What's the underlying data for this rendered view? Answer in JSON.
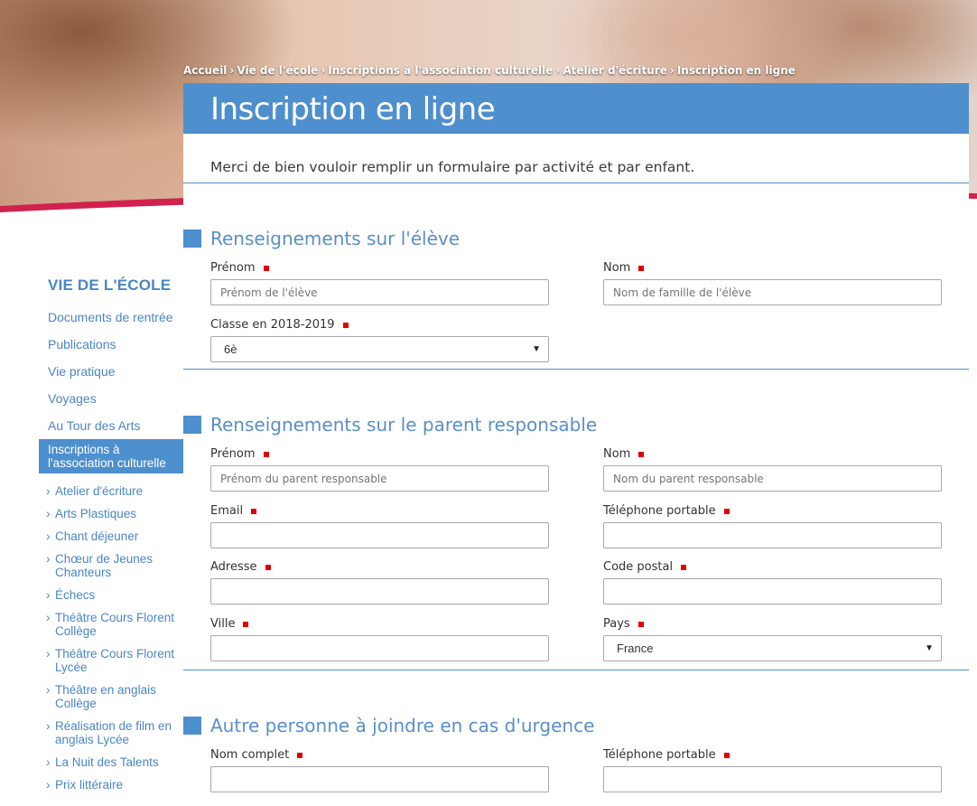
{
  "breadcrumb": {
    "items": [
      "Accueil",
      "Vie de l'école",
      "Inscriptions à l'association culturelle",
      "Atelier d'écriture",
      "Inscription en ligne"
    ]
  },
  "sidebar": {
    "title": "VIE DE L'ÉCOLE",
    "items": [
      "Documents de rentrée",
      "Publications",
      "Vie pratique",
      "Voyages",
      "Au Tour des Arts"
    ],
    "active": "Inscriptions à l'association culturelle",
    "subitems": [
      "Atelier d'écriture",
      "Arts Plastiques",
      "Chant déjeuner",
      "Chœur de Jeunes Chanteurs",
      "Échecs",
      "Théâtre Cours Florent Collège",
      "Théâtre Cours Florent Lycée",
      "Théâtre en anglais Collège",
      "Réalisation de film en anglais Lycée",
      "La Nuit des Talents",
      "Prix littéraire"
    ]
  },
  "page": {
    "title": "Inscription en ligne",
    "intro": "Merci de bien vouloir remplir un formulaire par activité et par enfant."
  },
  "sections": {
    "eleve": {
      "title": "Renseignements sur l'élève",
      "prenom": {
        "label": "Prénom",
        "placeholder": "Prénom de l'élève"
      },
      "nom": {
        "label": "Nom",
        "placeholder": "Nom de famille de l'élève"
      },
      "classe": {
        "label": "Classe en 2018-2019",
        "value": "6è"
      }
    },
    "parent": {
      "title": "Renseignements sur le parent responsable",
      "prenom": {
        "label": "Prénom",
        "placeholder": "Prénom du parent responsable"
      },
      "nom": {
        "label": "Nom",
        "placeholder": "Nom du parent responsable"
      },
      "email": {
        "label": "Email"
      },
      "telephone": {
        "label": "Téléphone portable"
      },
      "adresse": {
        "label": "Adresse"
      },
      "code_postal": {
        "label": "Code postal"
      },
      "ville": {
        "label": "Ville"
      },
      "pays": {
        "label": "Pays",
        "value": "France"
      }
    },
    "urgence": {
      "title": "Autre personne à joindre en cas d'urgence",
      "nom_complet": {
        "label": "Nom complet"
      },
      "telephone": {
        "label": "Téléphone portable"
      }
    }
  },
  "colors": {
    "accent": "#4e8fce",
    "link": "#4a86c5",
    "required": "#e00000",
    "swoosh": "#d0214f"
  },
  "icons": [
    "square-bullet-icon",
    "chevron-right-icon",
    "dropdown-arrow-icon"
  ]
}
